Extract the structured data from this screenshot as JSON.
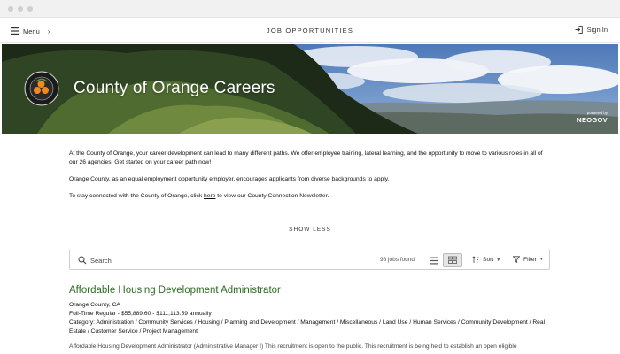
{
  "nav": {
    "menu_label": "Menu",
    "menu_chevron": "›",
    "title": "JOB OPPORTUNITIES",
    "signin_label": "Sign In",
    "menu_icon": "hamburger-icon",
    "signin_icon": "sign-in-icon"
  },
  "hero": {
    "title": "County of Orange Careers",
    "powered_by": "powered by",
    "brand": "NEOGOV",
    "seal_icon": "county-seal-logo"
  },
  "intro": {
    "p1": "At the County of Orange, your career development can lead to many different paths.  We offer employee training, lateral learning, and the opportunity to move to various roles in all of our 26 agencies.  Get started on your career path now!",
    "p2": "Orange County, as an equal employment opportunity employer, encourages applicants from diverse backgrounds to apply.",
    "p3_before": "To stay connected with the County of Orange, click ",
    "p3_link": "here",
    "p3_after": " to view our County Connection Newsletter."
  },
  "show_less_label": "SHOW LESS",
  "search": {
    "placeholder": "Search",
    "jobs_found": "98 jobs found",
    "sort_label": "Sort",
    "filter_label": "Filter"
  },
  "job": {
    "title": "Affordable Housing Development Administrator",
    "location": "Orange County, CA",
    "pay": "Full-Time Regular - $55,889.60 - $111,113.59 annually",
    "category": "Category: Administration / Community Services / Housing / Planning and Development / Management / Miscellaneous / Land Use / Human Services / Community Development / Real Estate / Customer Service / Project Management",
    "description": "Affordable Housing Development Administrator (Administrative Manager I) This recruitment is open to the public.  This recruitment is being held to establish an open eligible"
  },
  "colors": {
    "job_title": "#2e6b24",
    "sky": "#5b86c2",
    "hero_text": "#ffffff"
  }
}
